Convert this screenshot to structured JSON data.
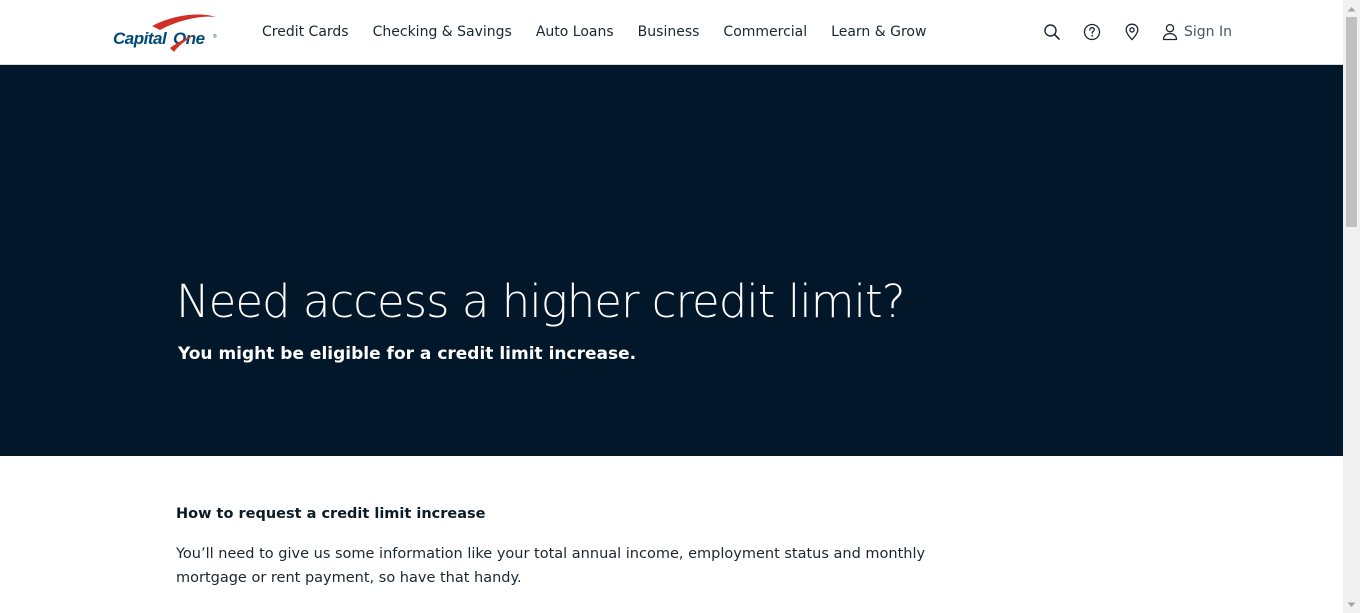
{
  "header": {
    "logo_text": "Capital One",
    "nav": [
      {
        "label": "Credit Cards"
      },
      {
        "label": "Checking & Savings"
      },
      {
        "label": "Auto Loans"
      },
      {
        "label": "Business"
      },
      {
        "label": "Commercial"
      },
      {
        "label": "Learn & Grow"
      }
    ],
    "actions": {
      "search_icon": "search-icon",
      "help_icon": "help-circle-icon",
      "location_icon": "location-pin-icon",
      "user_icon": "user-icon",
      "signin_label": "Sign In"
    }
  },
  "hero": {
    "title": "Need access a higher credit limit?",
    "subtitle": "You might be eligible for a credit limit increase.",
    "background_color": "#03172a"
  },
  "content": {
    "heading": "How to request a credit limit increase",
    "body": "You’ll need to give us some information like your total annual income, employment status and monthly mortgage or rent payment, so have that handy."
  },
  "colors": {
    "brand_navy": "#004977",
    "brand_red": "#d03027",
    "hero_bg": "#03172a"
  }
}
